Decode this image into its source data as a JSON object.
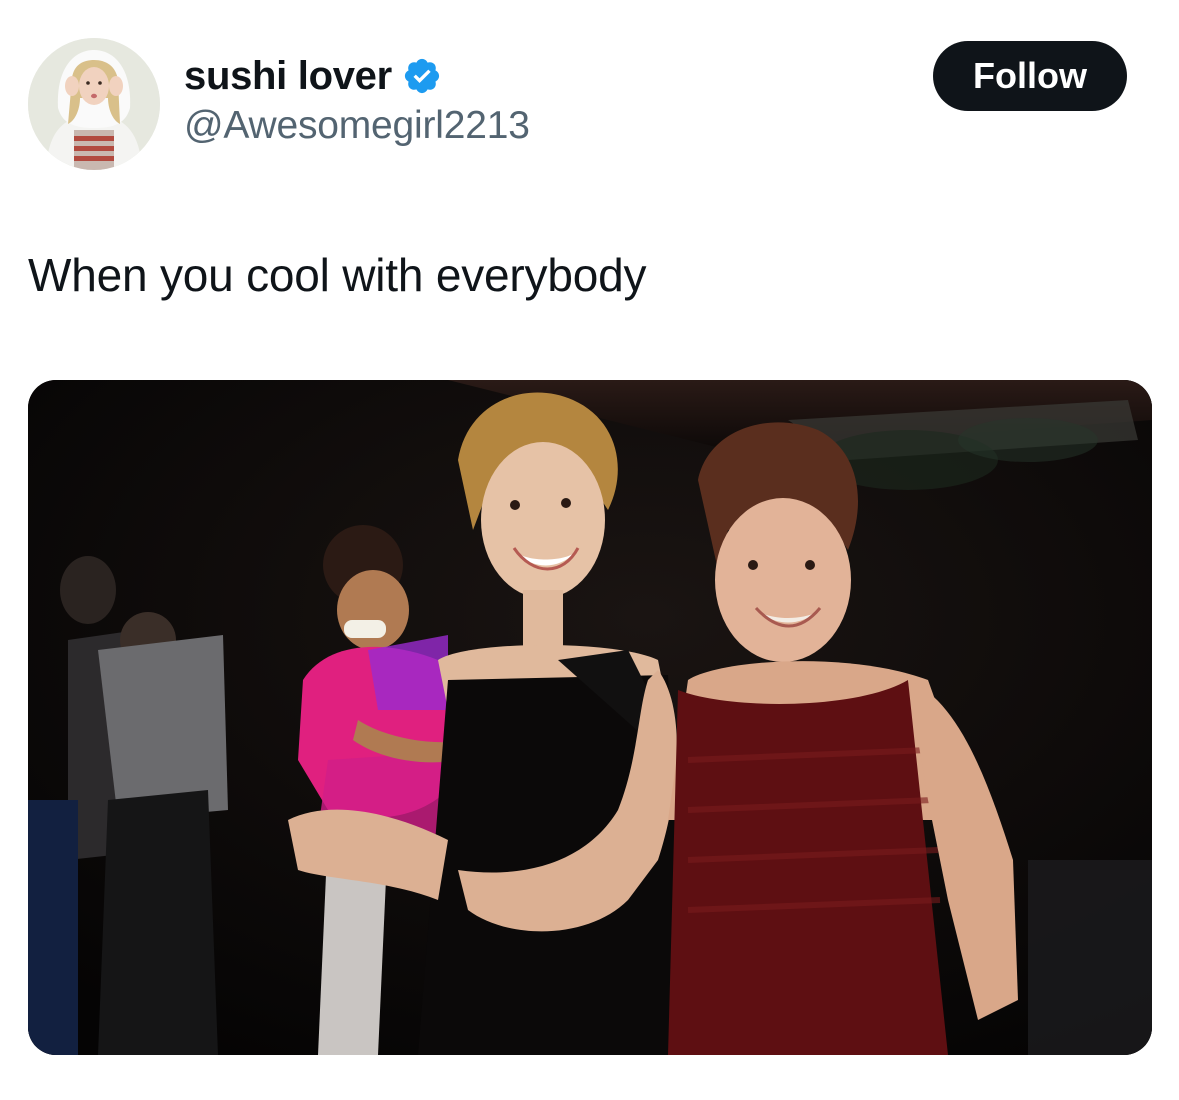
{
  "author": {
    "display_name": "sushi lover",
    "handle": "@Awesomegirl2213",
    "verified": true,
    "verified_icon": "verified-badge-icon",
    "avatar_icon": "avatar"
  },
  "follow_label": "Follow",
  "tweet": {
    "text": "When you cool with everybody"
  },
  "colors": {
    "text_primary": "#0f1419",
    "text_secondary": "#536471",
    "verified_blue": "#1d9bf0",
    "button_bg": "#0f1419",
    "button_text": "#ffffff"
  }
}
